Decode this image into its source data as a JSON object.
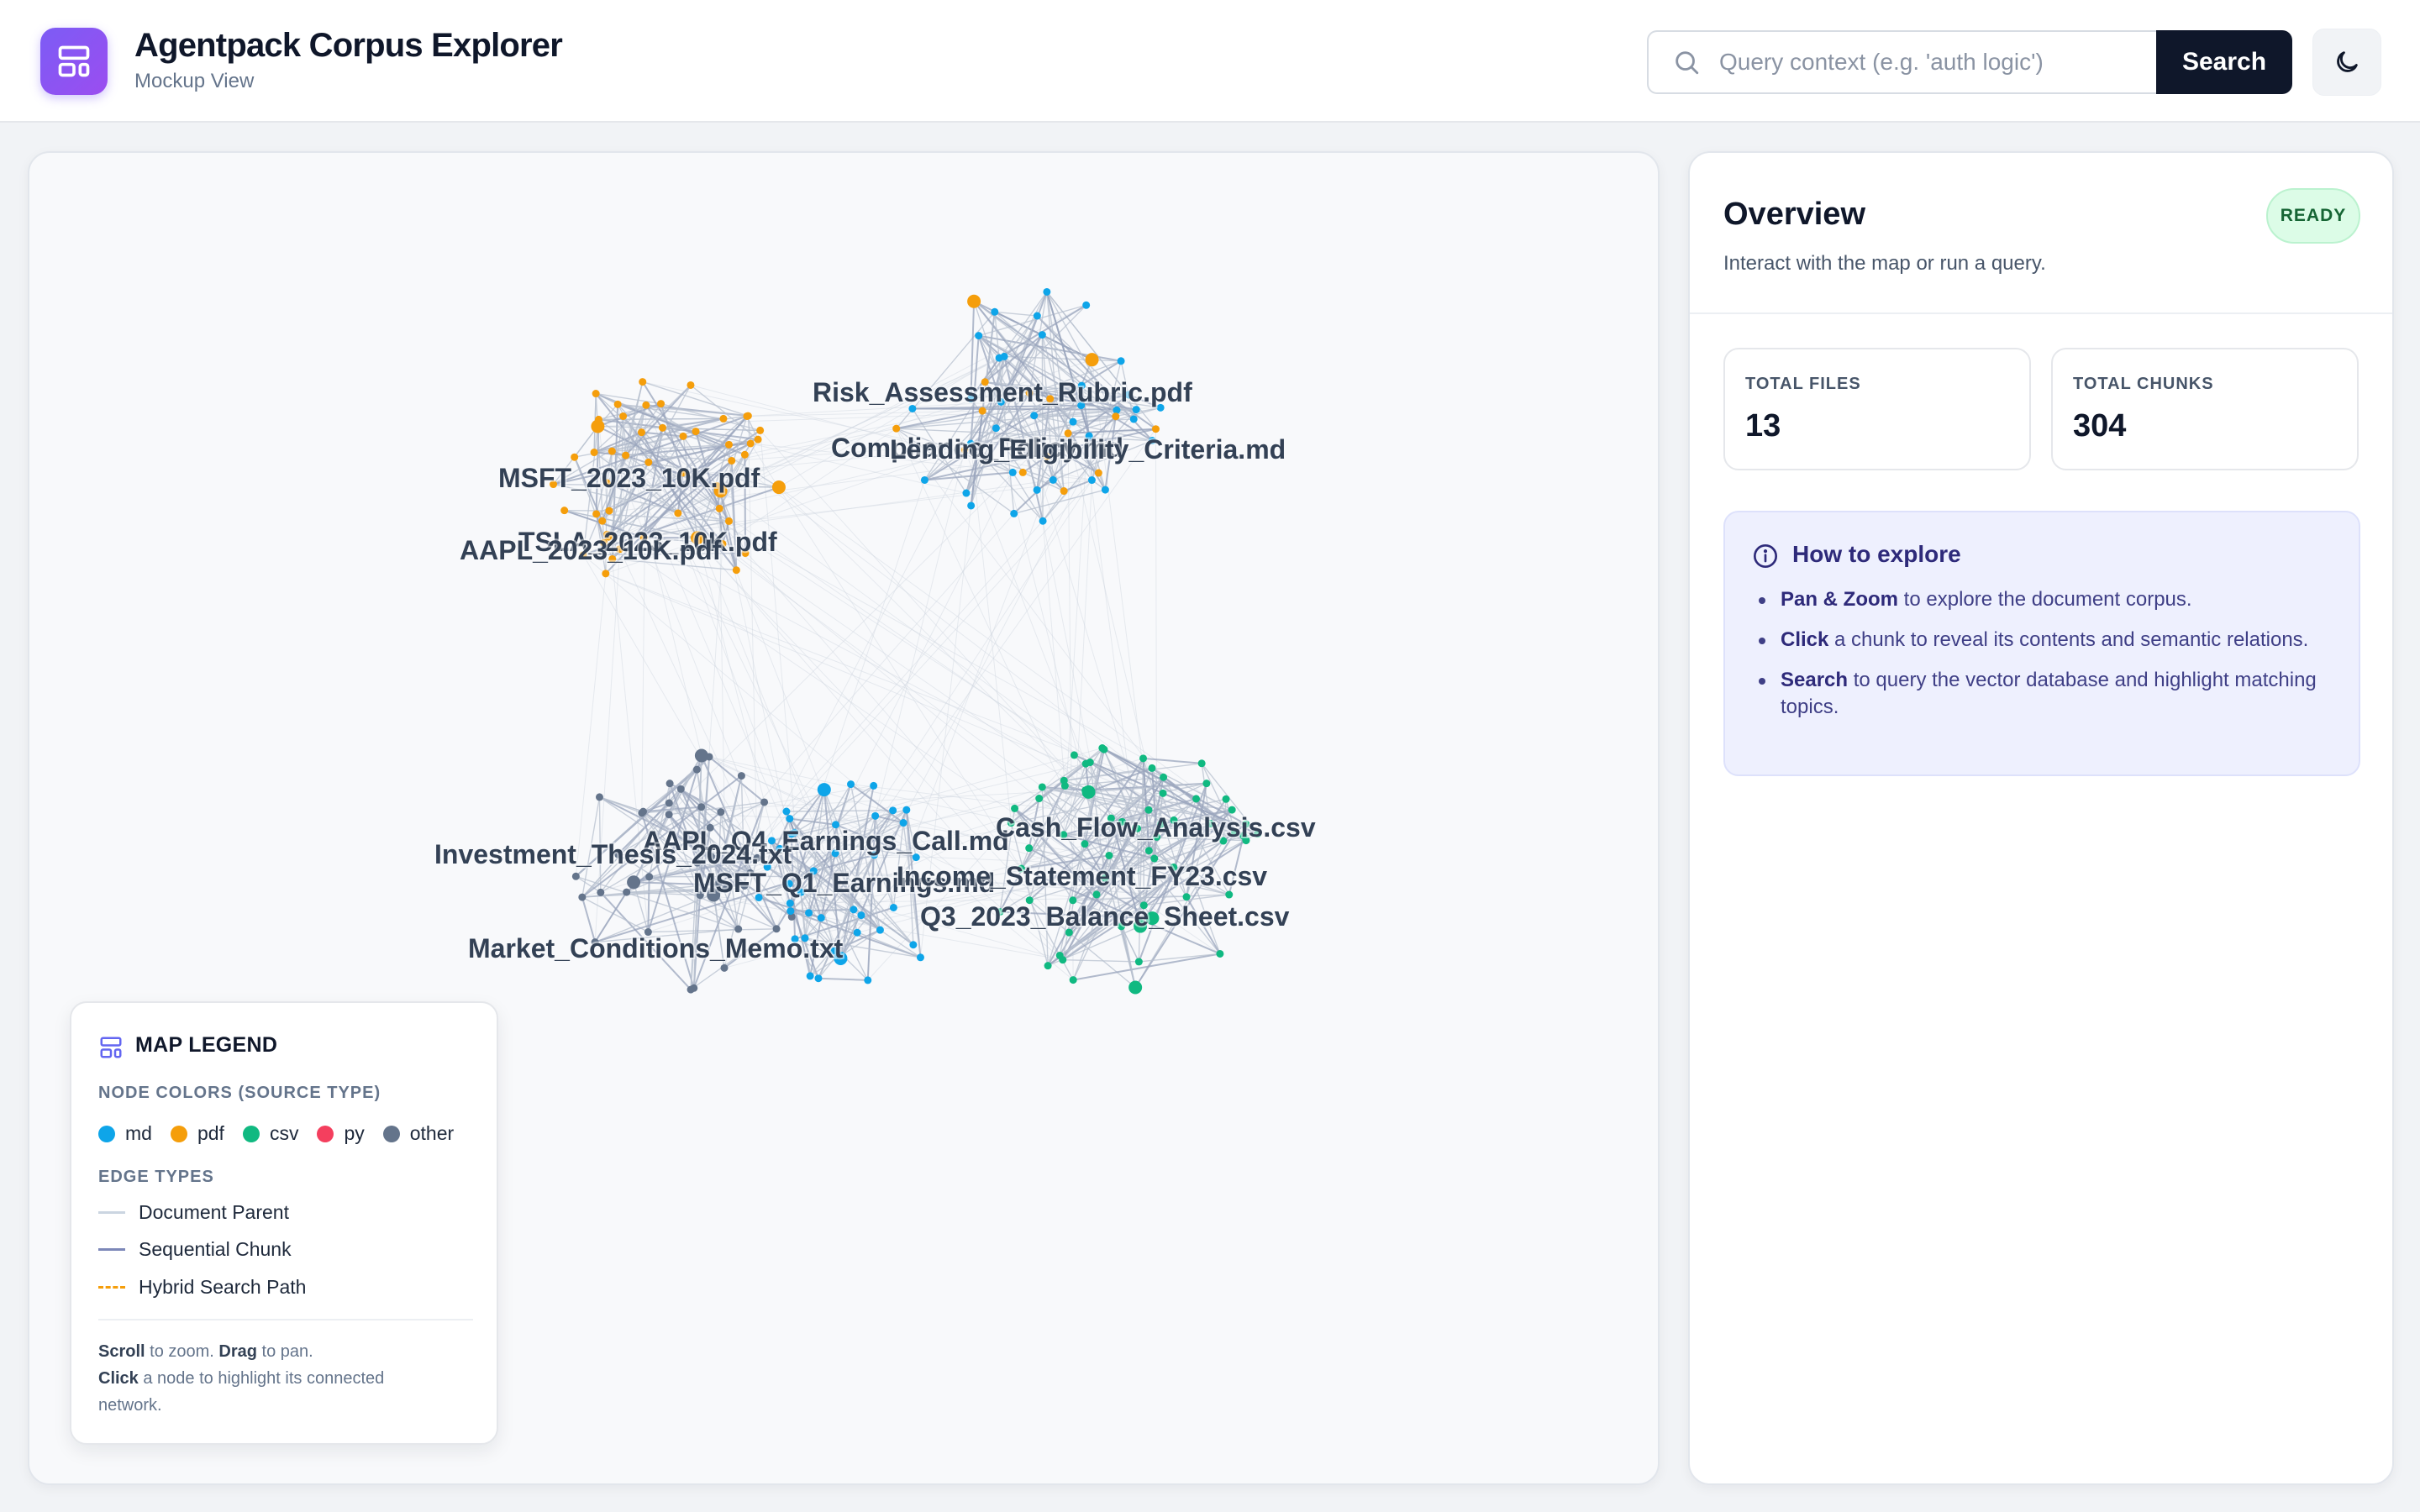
{
  "app": {
    "title": "Agentpack Corpus Explorer",
    "subtitle": "Mockup View"
  },
  "search": {
    "placeholder": "Query context (e.g. 'auth logic')",
    "button_label": "Search"
  },
  "icons": {
    "app_logo": "layout-template-icon",
    "search": "search-icon",
    "theme_toggle": "moon-icon",
    "legend": "layout-icon",
    "help": "info-icon"
  },
  "colors": {
    "md": "#0ea5e9",
    "pdf": "#f59e0b",
    "csv": "#10b981",
    "py": "#f43f5e",
    "other": "#64748b",
    "accent": "#7c5cf5"
  },
  "map": {
    "document_labels": [
      "Risk_Assessment_Rubric.pdf",
      "Compliance_Policy.md",
      "Lending_Eligibility_Criteria.md",
      "MSFT_2023_10K.pdf",
      "TSLA_2023_10K.pdf",
      "AAPL_2023_10K.pdf",
      "AAPL_Q4_Earnings_Call.md",
      "Investment_Thesis_2024.txt",
      "MSFT_Q1_Earnings.md",
      "Market_Conditions_Memo.txt",
      "Cash_Flow_Analysis.csv",
      "Income_Statement_FY23.csv",
      "Q3_2023_Balance_Sheet.csv"
    ]
  },
  "legend": {
    "title": "MAP LEGEND",
    "node_colors_title": "NODE COLORS (SOURCE TYPE)",
    "node_types": [
      {
        "label": "md",
        "color": "#0ea5e9"
      },
      {
        "label": "pdf",
        "color": "#f59e0b"
      },
      {
        "label": "csv",
        "color": "#10b981"
      },
      {
        "label": "py",
        "color": "#f43f5e"
      },
      {
        "label": "other",
        "color": "#64748b"
      }
    ],
    "edge_types_title": "EDGE TYPES",
    "edge_types": [
      {
        "label": "Document Parent"
      },
      {
        "label": "Sequential Chunk"
      },
      {
        "label": "Hybrid Search Path"
      }
    ],
    "help_line1_a": "Scroll",
    "help_line1_b": " to zoom. ",
    "help_line1_c": "Drag",
    "help_line1_d": " to pan.",
    "help_line2_a": "Click",
    "help_line2_b": " a node to highlight its connected",
    "help_line3": "network."
  },
  "overview": {
    "title": "Overview",
    "subtitle": "Interact with the map or run a query.",
    "status": "READY",
    "stats": [
      {
        "label": "TOTAL FILES",
        "value": "13"
      },
      {
        "label": "TOTAL CHUNKS",
        "value": "304"
      }
    ],
    "help": {
      "title": "How to explore",
      "items": [
        {
          "bold": "Pan & Zoom",
          "text": " to explore the document corpus."
        },
        {
          "bold": "Click",
          "text": " a chunk to reveal its contents and semantic relations."
        },
        {
          "bold": "Search",
          "text": " to query the vector database and highlight matching topics."
        }
      ]
    }
  }
}
